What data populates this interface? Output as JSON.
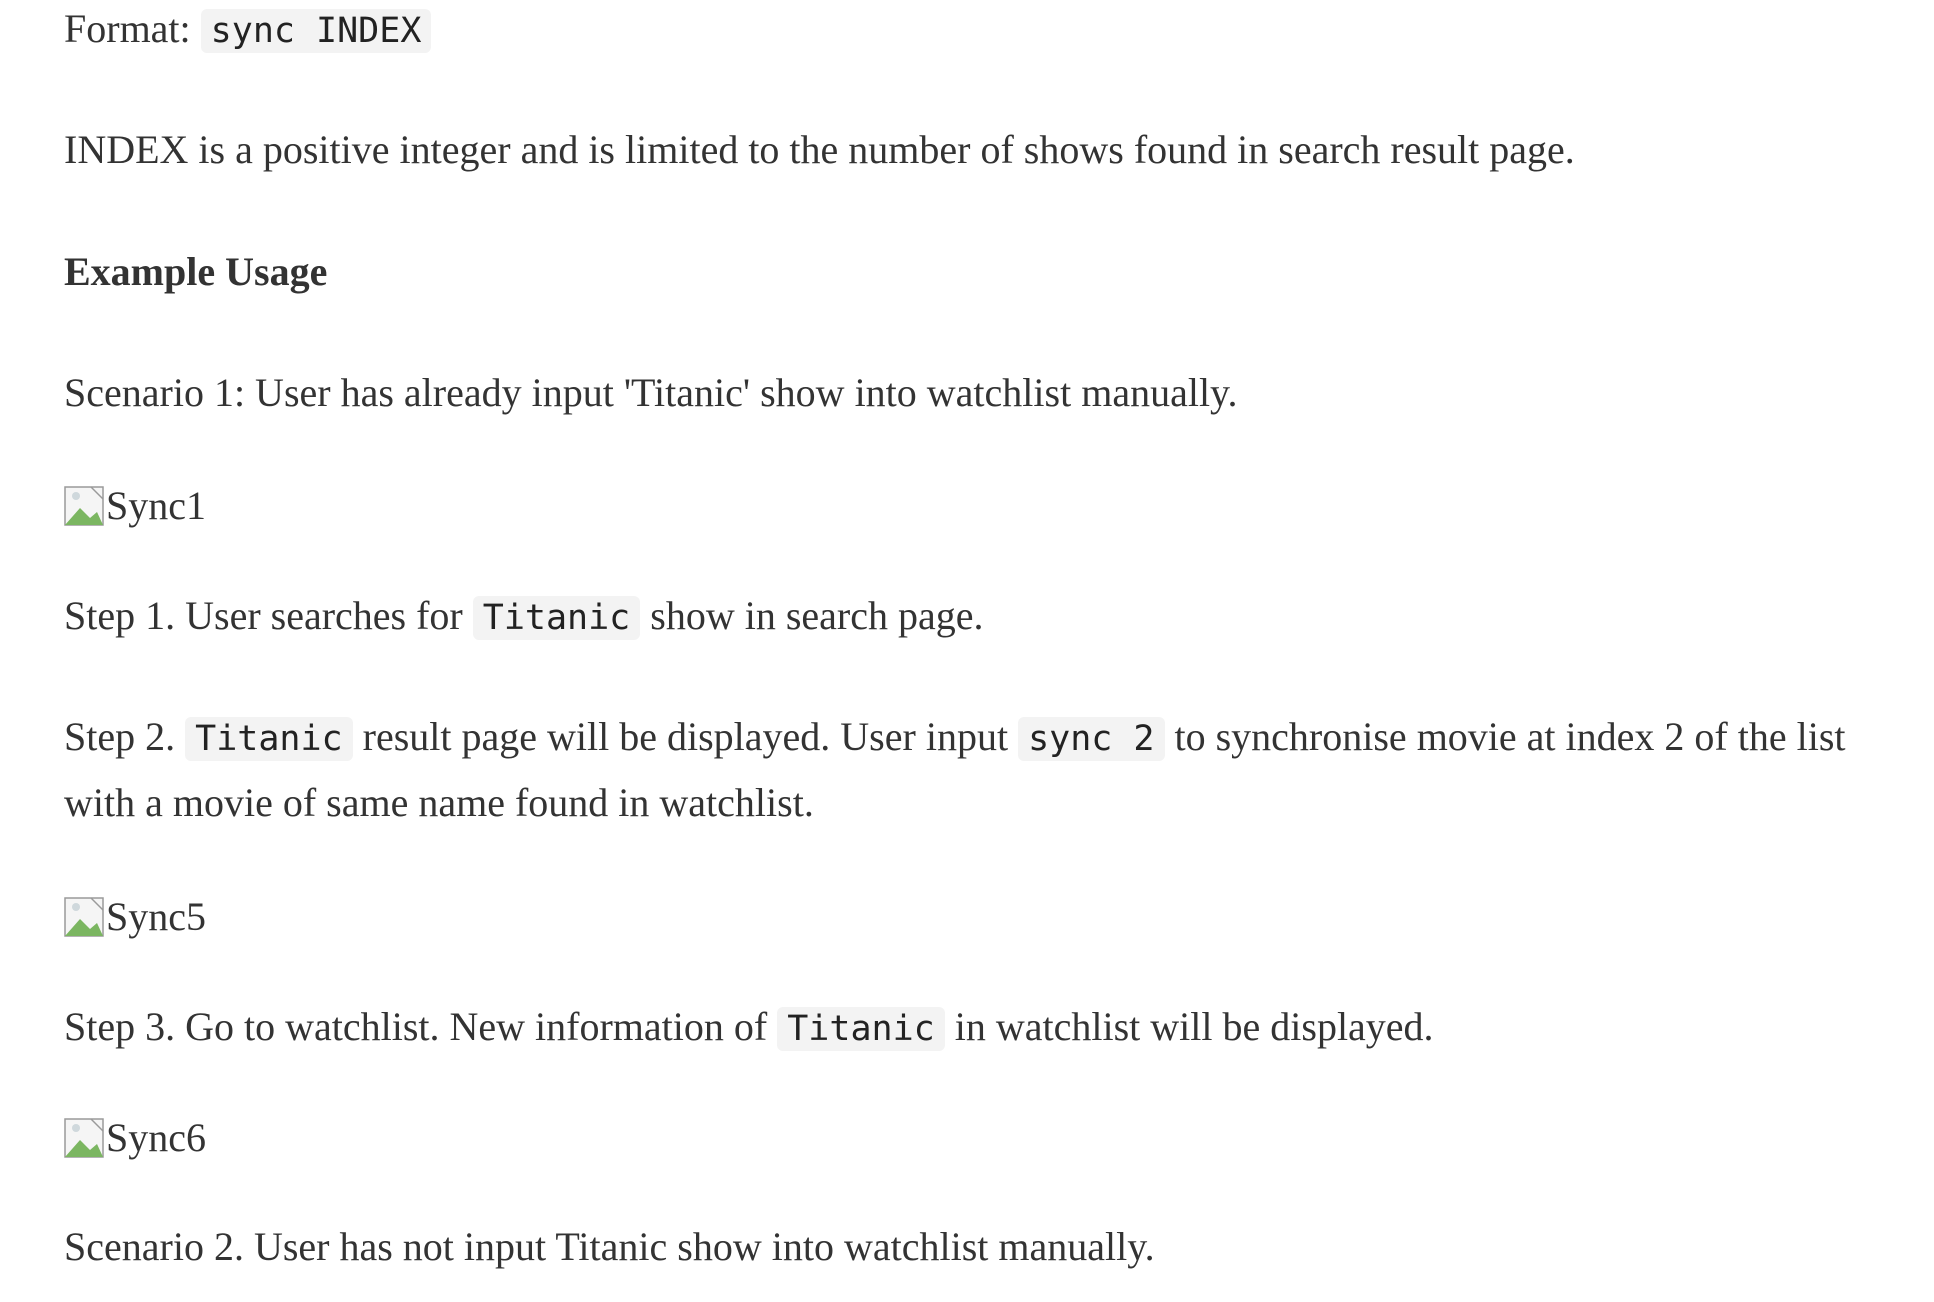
{
  "format_line": {
    "label": "Format:",
    "code": "sync INDEX"
  },
  "index_desc": "INDEX is a positive integer and is limited to the number of shows found in search result page.",
  "example_heading": "Example Usage",
  "scenario1": "Scenario 1: User has already input 'Titanic' show into watchlist manually.",
  "image1_alt": "Sync1",
  "step1": {
    "before": "Step 1. User searches for",
    "code": "Titanic",
    "after": "show in search page."
  },
  "step2": {
    "before": "Step 2.",
    "code1": "Titanic",
    "middle": "result page will be displayed. User input",
    "code2": "sync 2",
    "after": "to synchronise movie at index 2 of the list",
    "line2": "with a movie of same name found in watchlist."
  },
  "image2_alt": "Sync5",
  "step3": {
    "before": "Step 3. Go to watchlist. New information of",
    "code": "Titanic",
    "after": "in watchlist will be displayed."
  },
  "image3_alt": "Sync6",
  "scenario2": "Scenario 2. User has not input Titanic show into watchlist manually.",
  "icons": {
    "broken_image": "broken-image-icon"
  }
}
